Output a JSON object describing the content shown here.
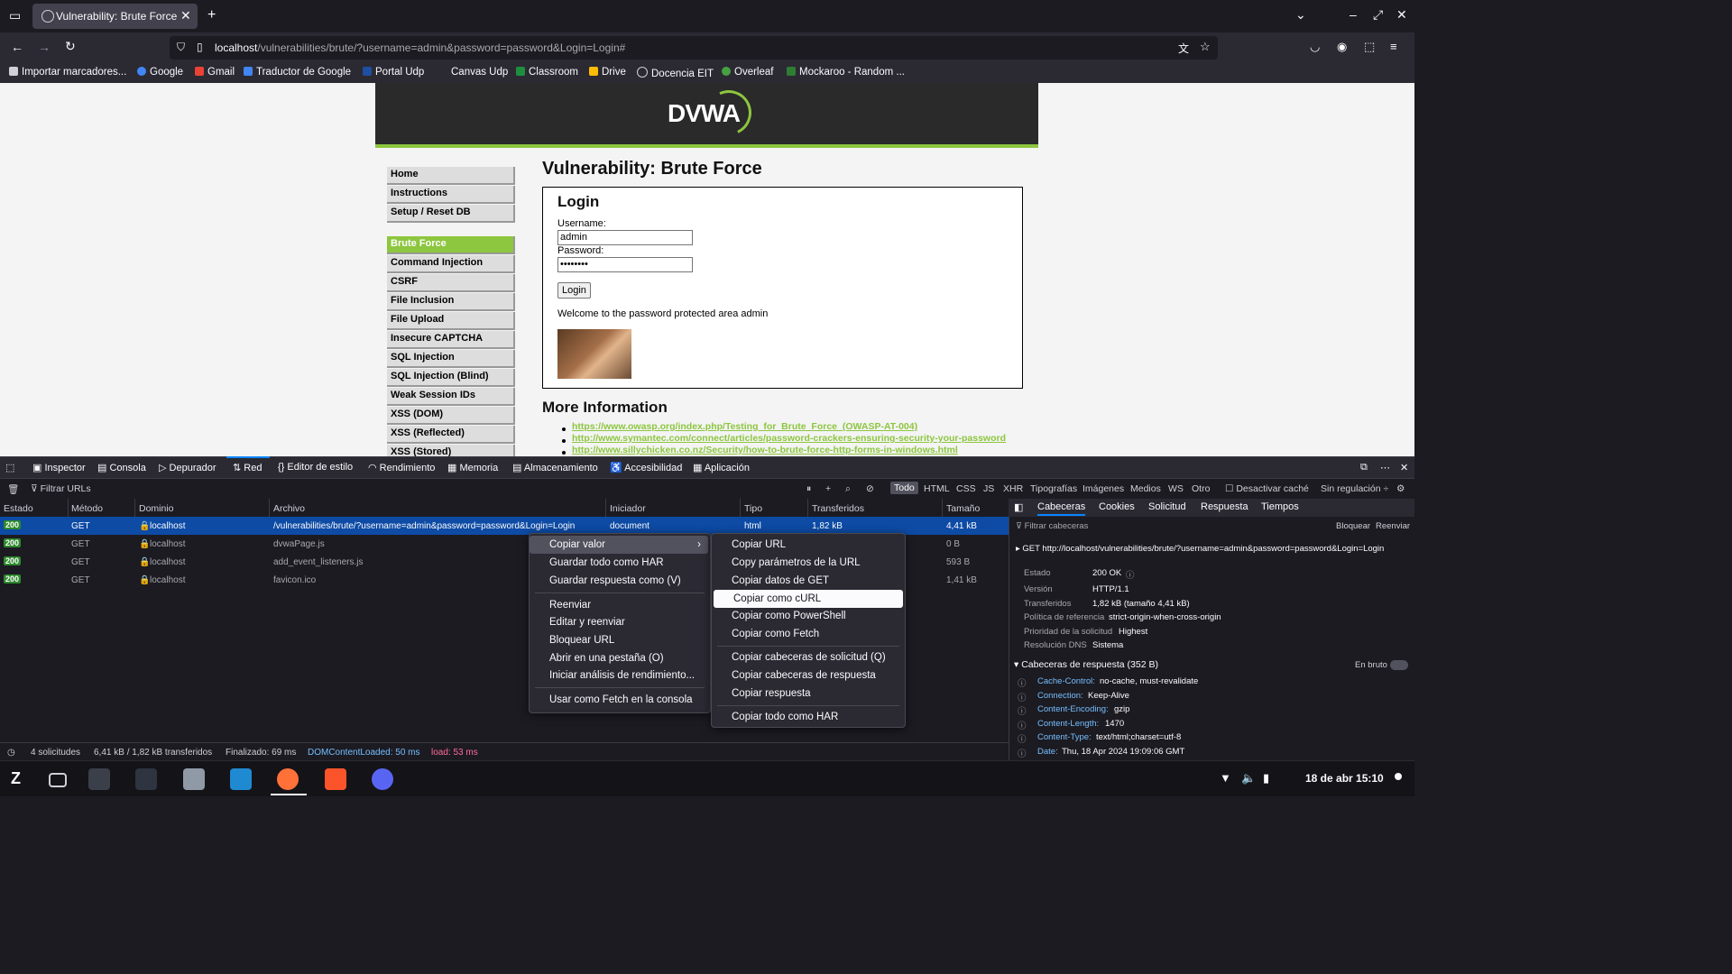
{
  "browser": {
    "tab_title": "Vulnerability: Brute Force",
    "url_host": "localhost",
    "url_path": "/vulnerabilities/brute/?username=admin&password=password&Login=Login#",
    "bookmarks": [
      "Importar marcadores...",
      "Google",
      "Gmail",
      "Traductor de Google",
      "Portal Udp",
      "Canvas Udp",
      "Classroom",
      "Drive",
      "Docencia EIT",
      "Overleaf",
      "Mockaroo - Random ..."
    ]
  },
  "page": {
    "logo": "DVWA",
    "menu": [
      "Home",
      "Instructions",
      "Setup / Reset DB",
      "Brute Force",
      "Command Injection",
      "CSRF",
      "File Inclusion",
      "File Upload",
      "Insecure CAPTCHA",
      "SQL Injection",
      "SQL Injection (Blind)",
      "Weak Session IDs",
      "XSS (DOM)",
      "XSS (Reflected)",
      "XSS (Stored)"
    ],
    "title": "Vulnerability: Brute Force",
    "login_title": "Login",
    "username_label": "Username:",
    "username_value": "admin",
    "password_label": "Password:",
    "password_value": "••••••••",
    "login_button": "Login",
    "welcome": "Welcome to the password protected area admin",
    "more_title": "More Information",
    "links": [
      "https://www.owasp.org/index.php/Testing_for_Brute_Force_(OWASP-AT-004)",
      "http://www.symantec.com/connect/articles/password-crackers-ensuring-security-your-password",
      "http://www.sillychicken.co.nz/Security/how-to-brute-force-http-forms-in-windows.html"
    ]
  },
  "devtools": {
    "tabs": [
      "Inspector",
      "Consola",
      "Depurador",
      "Red",
      "Editor de estilo",
      "Rendimiento",
      "Memoria",
      "Almacenamiento",
      "Accesibilidad",
      "Aplicación"
    ],
    "filter_placeholder": "Filtrar URLs",
    "type_filters": [
      "Todo",
      "HTML",
      "CSS",
      "JS",
      "XHR",
      "Tipografías",
      "Imágenes",
      "Medios",
      "WS",
      "Otro"
    ],
    "disable_cache": "Desactivar caché",
    "throttle": "Sin regulación ÷",
    "columns": [
      "Estado",
      "Método",
      "Dominio",
      "Archivo",
      "Iniciador",
      "Tipo",
      "Transferidos",
      "Tamaño"
    ],
    "rows": [
      {
        "status": "200",
        "method": "GET",
        "domain": "localhost",
        "file": "/vulnerabilities/brute/?username=admin&password=password&Login=Login",
        "initiator": "document",
        "type": "html",
        "transferred": "1,82 kB",
        "size": "4,41 kB"
      },
      {
        "status": "200",
        "method": "GET",
        "domain": "localhost",
        "file": "dvwaPage.js",
        "initiator": "",
        "type": "",
        "transferred": "",
        "size": "0 B"
      },
      {
        "status": "200",
        "method": "GET",
        "domain": "localhost",
        "file": "add_event_listeners.js",
        "initiator": "",
        "type": "",
        "transferred": "",
        "size": "593 B"
      },
      {
        "status": "200",
        "method": "GET",
        "domain": "localhost",
        "file": "favicon.ico",
        "initiator": "",
        "type": "",
        "transferred": "",
        "size": "1,41 kB"
      }
    ],
    "status_bar": {
      "requests": "4 solicitudes",
      "transferred": "6,41 kB / 1,82 kB transferidos",
      "finished": "Finalizado: 69 ms",
      "dom": "DOMContentLoaded: 50 ms",
      "load": "load: 53 ms"
    },
    "side_tabs": [
      "Cabeceras",
      "Cookies",
      "Solicitud",
      "Respuesta",
      "Tiempos"
    ],
    "filter_headers": "Filtrar cabeceras",
    "block": "Bloquear",
    "resend": "Reenviar",
    "request_line": "GET http://localhost/vulnerabilities/brute/?username=admin&password=password&Login=Login",
    "summary": [
      {
        "k": "Estado",
        "v": "200 OK"
      },
      {
        "k": "Versión",
        "v": "HTTP/1.1"
      },
      {
        "k": "Transferidos",
        "v": "1,82 kB (tamaño 4,41 kB)"
      },
      {
        "k": "Política de referencia",
        "v": "strict-origin-when-cross-origin"
      },
      {
        "k": "Prioridad de la solicitud",
        "v": "Highest"
      },
      {
        "k": "Resolución DNS",
        "v": "Sistema"
      }
    ],
    "response_headers_title": "Cabeceras de respuesta (352 B)",
    "raw": "En bruto",
    "response_headers": [
      {
        "k": "Cache-Control:",
        "v": "no-cache, must-revalidate"
      },
      {
        "k": "Connection:",
        "v": "Keep-Alive"
      },
      {
        "k": "Content-Encoding:",
        "v": "gzip"
      },
      {
        "k": "Content-Length:",
        "v": "1470"
      },
      {
        "k": "Content-Type:",
        "v": "text/html;charset=utf-8"
      },
      {
        "k": "Date:",
        "v": "Thu, 18 Apr 2024 19:09:06 GMT"
      }
    ]
  },
  "context_menu": {
    "main": [
      "Copiar valor",
      "Guardar todo como HAR",
      "Guardar respuesta como (V)",
      "Reenviar",
      "Editar y reenviar",
      "Bloquear URL",
      "Abrir en una pestaña (O)",
      "Iniciar análisis de rendimiento...",
      "Usar como Fetch en la consola"
    ],
    "sub": [
      "Copiar URL",
      "Copy parámetros de la URL",
      "Copiar datos de GET",
      "Copiar como cURL",
      "Copiar como PowerShell",
      "Copiar como Fetch",
      "Copiar cabeceras de solicitud (Q)",
      "Copiar cabeceras de respuesta",
      "Copiar respuesta",
      "Copiar todo como HAR"
    ]
  },
  "taskbar": {
    "clock": "18 de abr  15:10"
  }
}
